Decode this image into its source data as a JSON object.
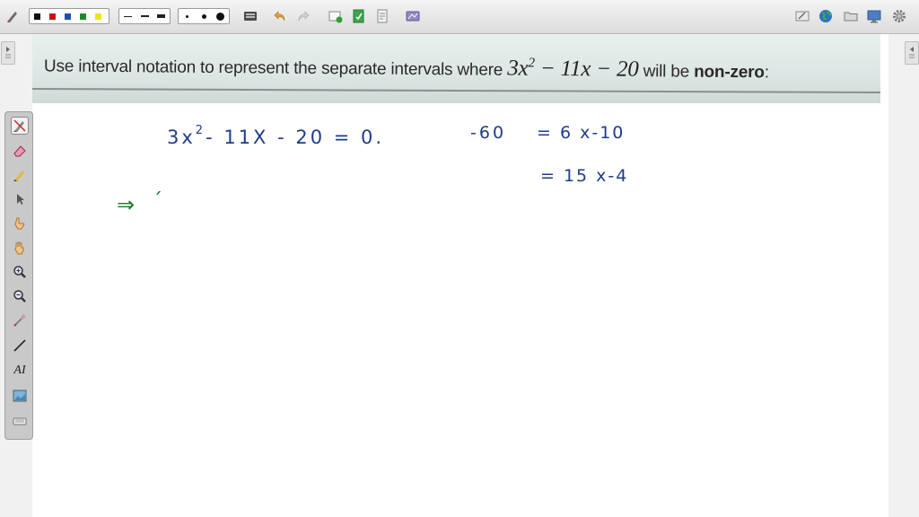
{
  "question": {
    "prefix": "Use interval notation to represent the separate intervals where ",
    "base": "3x",
    "exponent": "2",
    "expr_rest": " − 11x − 20",
    "middle": " will be ",
    "emphasis": "non-zero",
    "suffix": ":"
  },
  "handwriting": {
    "equation_main": "3x",
    "equation_sup": "2",
    "equation_rest": "- 11X - 20 = 0.",
    "product": "-60",
    "factor_pair_1": "= 6 x-10",
    "factor_pair_2": "= 15 x-4",
    "implies": "⇒",
    "tick": "ˊ"
  },
  "colors": {
    "ink_blue": "#1f3c8a",
    "ink_green": "#1a7a2a",
    "swatch_black": "#111111",
    "swatch_red": "#d01010",
    "swatch_blue": "#1a4fb5",
    "swatch_green": "#1f8a2a",
    "swatch_yellow": "#f2e21a"
  },
  "toolbar_icons": [
    "pen-settings-icon",
    "undo-icon",
    "redo-icon",
    "new-page-icon",
    "insert-page-icon",
    "document-icon",
    "screen-capture-icon",
    "clear-icon",
    "globe-icon",
    "folder-icon",
    "display-icon",
    "settings-gear-icon"
  ],
  "palette_icons": [
    "pen-tool-icon",
    "eraser-icon",
    "highlighter-icon",
    "select-arrow-icon",
    "pointer-hand-icon",
    "pan-hand-icon",
    "zoom-in-icon",
    "zoom-out-icon",
    "color-picker-icon",
    "line-tool-icon",
    "text-tool-icon",
    "image-tool-icon",
    "keyboard-icon"
  ],
  "palette_text_label": "AI"
}
